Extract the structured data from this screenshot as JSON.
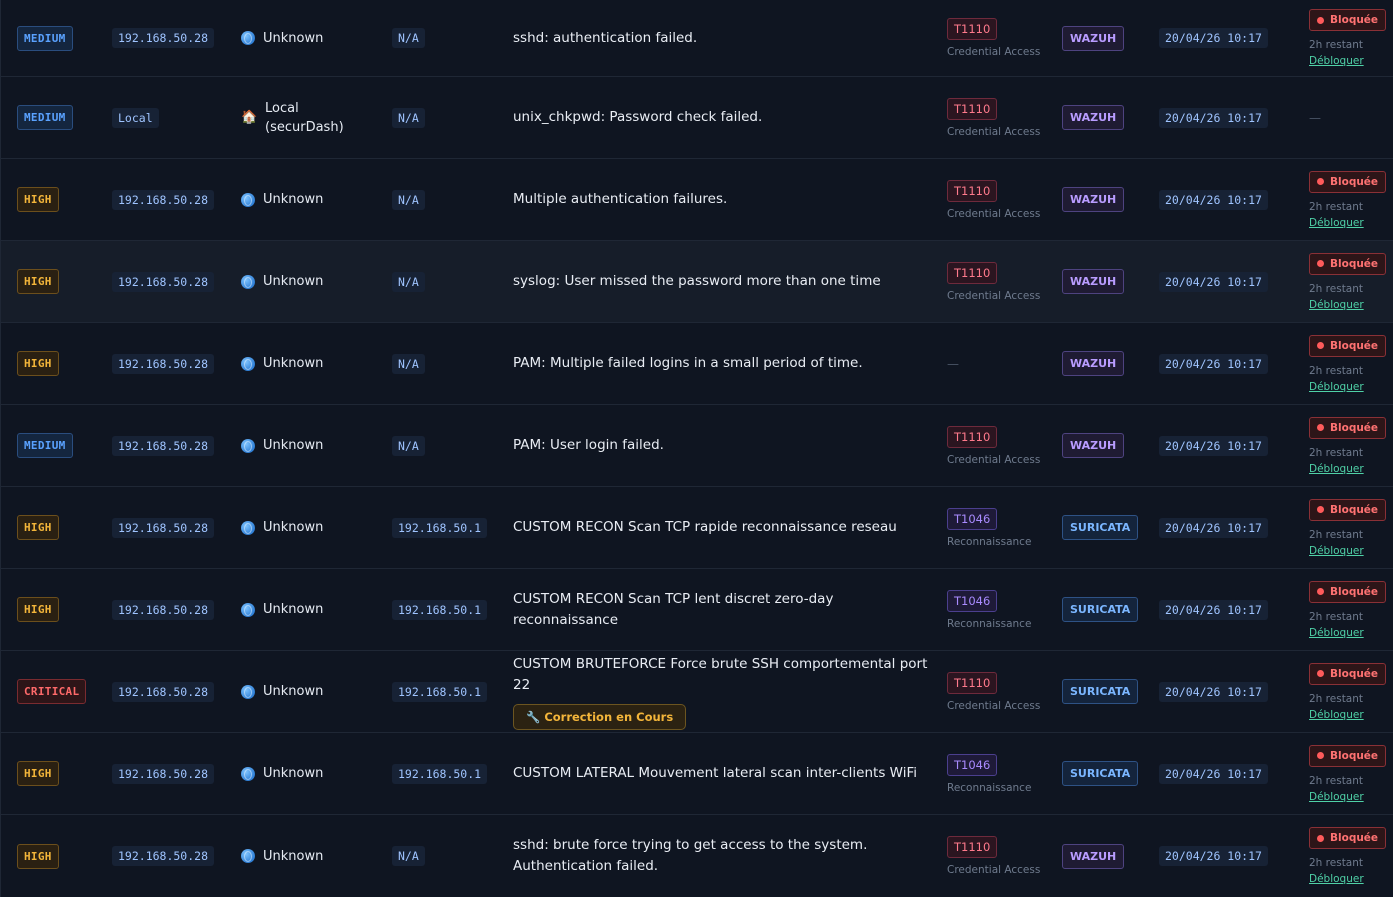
{
  "labels": {
    "blocked": "Bloquée",
    "remaining": "2h restant",
    "unblock": "Débloquer",
    "none": "—"
  },
  "rows": [
    {
      "severity": "MEDIUM",
      "ip": "192.168.50.28",
      "location": "Unknown",
      "location_icon": "globe-icon",
      "dest": "N/A",
      "description": "sshd: authentication failed.",
      "tech_id": "T1110",
      "tech_name": "Credential Access",
      "source": "WAZUH",
      "date": "20/04/26 10:17",
      "blocked": true
    },
    {
      "severity": "MEDIUM",
      "ip": "Local",
      "location": "Local (securDash)",
      "location_icon": "house-icon",
      "dest": "N/A",
      "description": "unix_chkpwd: Password check failed.",
      "tech_id": "T1110",
      "tech_name": "Credential Access",
      "source": "WAZUH",
      "date": "20/04/26 10:17",
      "blocked": false
    },
    {
      "severity": "HIGH",
      "ip": "192.168.50.28",
      "location": "Unknown",
      "location_icon": "globe-icon",
      "dest": "N/A",
      "description": "Multiple authentication failures.",
      "tech_id": "T1110",
      "tech_name": "Credential Access",
      "source": "WAZUH",
      "date": "20/04/26 10:17",
      "blocked": true
    },
    {
      "severity": "HIGH",
      "ip": "192.168.50.28",
      "location": "Unknown",
      "location_icon": "globe-icon",
      "dest": "N/A",
      "description": "syslog: User missed the password more than one time",
      "tech_id": "T1110",
      "tech_name": "Credential Access",
      "source": "WAZUH",
      "date": "20/04/26 10:17",
      "blocked": true
    },
    {
      "severity": "HIGH",
      "ip": "192.168.50.28",
      "location": "Unknown",
      "location_icon": "globe-icon",
      "dest": "N/A",
      "description": "PAM: Multiple failed logins in a small period of time.",
      "tech_id": "",
      "tech_name": "",
      "source": "WAZUH",
      "date": "20/04/26 10:17",
      "blocked": true
    },
    {
      "severity": "MEDIUM",
      "ip": "192.168.50.28",
      "location": "Unknown",
      "location_icon": "globe-icon",
      "dest": "N/A",
      "description": "PAM: User login failed.",
      "tech_id": "T1110",
      "tech_name": "Credential Access",
      "source": "WAZUH",
      "date": "20/04/26 10:17",
      "blocked": true
    },
    {
      "severity": "HIGH",
      "ip": "192.168.50.28",
      "location": "Unknown",
      "location_icon": "globe-icon",
      "dest": "192.168.50.1",
      "description": "CUSTOM RECON Scan TCP rapide reconnaissance reseau",
      "tech_id": "T1046",
      "tech_name": "Reconnaissance",
      "source": "SURICATA",
      "date": "20/04/26 10:17",
      "blocked": true
    },
    {
      "severity": "HIGH",
      "ip": "192.168.50.28",
      "location": "Unknown",
      "location_icon": "globe-icon",
      "dest": "192.168.50.1",
      "description": "CUSTOM RECON Scan TCP lent discret zero-day reconnaissance",
      "tech_id": "T1046",
      "tech_name": "Reconnaissance",
      "source": "SURICATA",
      "date": "20/04/26 10:17",
      "blocked": true
    },
    {
      "severity": "CRITICAL",
      "ip": "192.168.50.28",
      "location": "Unknown",
      "location_icon": "globe-icon",
      "dest": "192.168.50.1",
      "description": "CUSTOM BRUTEFORCE Force brute SSH comportemental port 22",
      "badge": "🔧 Correction en Cours",
      "tech_id": "T1110",
      "tech_name": "Credential Access",
      "source": "SURICATA",
      "date": "20/04/26 10:17",
      "blocked": true
    },
    {
      "severity": "HIGH",
      "ip": "192.168.50.28",
      "location": "Unknown",
      "location_icon": "globe-icon",
      "dest": "192.168.50.1",
      "description": "CUSTOM LATERAL Mouvement lateral scan inter-clients WiFi",
      "tech_id": "T1046",
      "tech_name": "Reconnaissance",
      "source": "SURICATA",
      "date": "20/04/26 10:17",
      "blocked": true
    },
    {
      "severity": "HIGH",
      "ip": "192.168.50.28",
      "location": "Unknown",
      "location_icon": "globe-icon",
      "dest": "N/A",
      "description": "sshd: brute force trying to get access to the system. Authentication failed.",
      "tech_id": "T1110",
      "tech_name": "Credential Access",
      "source": "WAZUH",
      "date": "20/04/26 10:17",
      "blocked": true
    }
  ]
}
